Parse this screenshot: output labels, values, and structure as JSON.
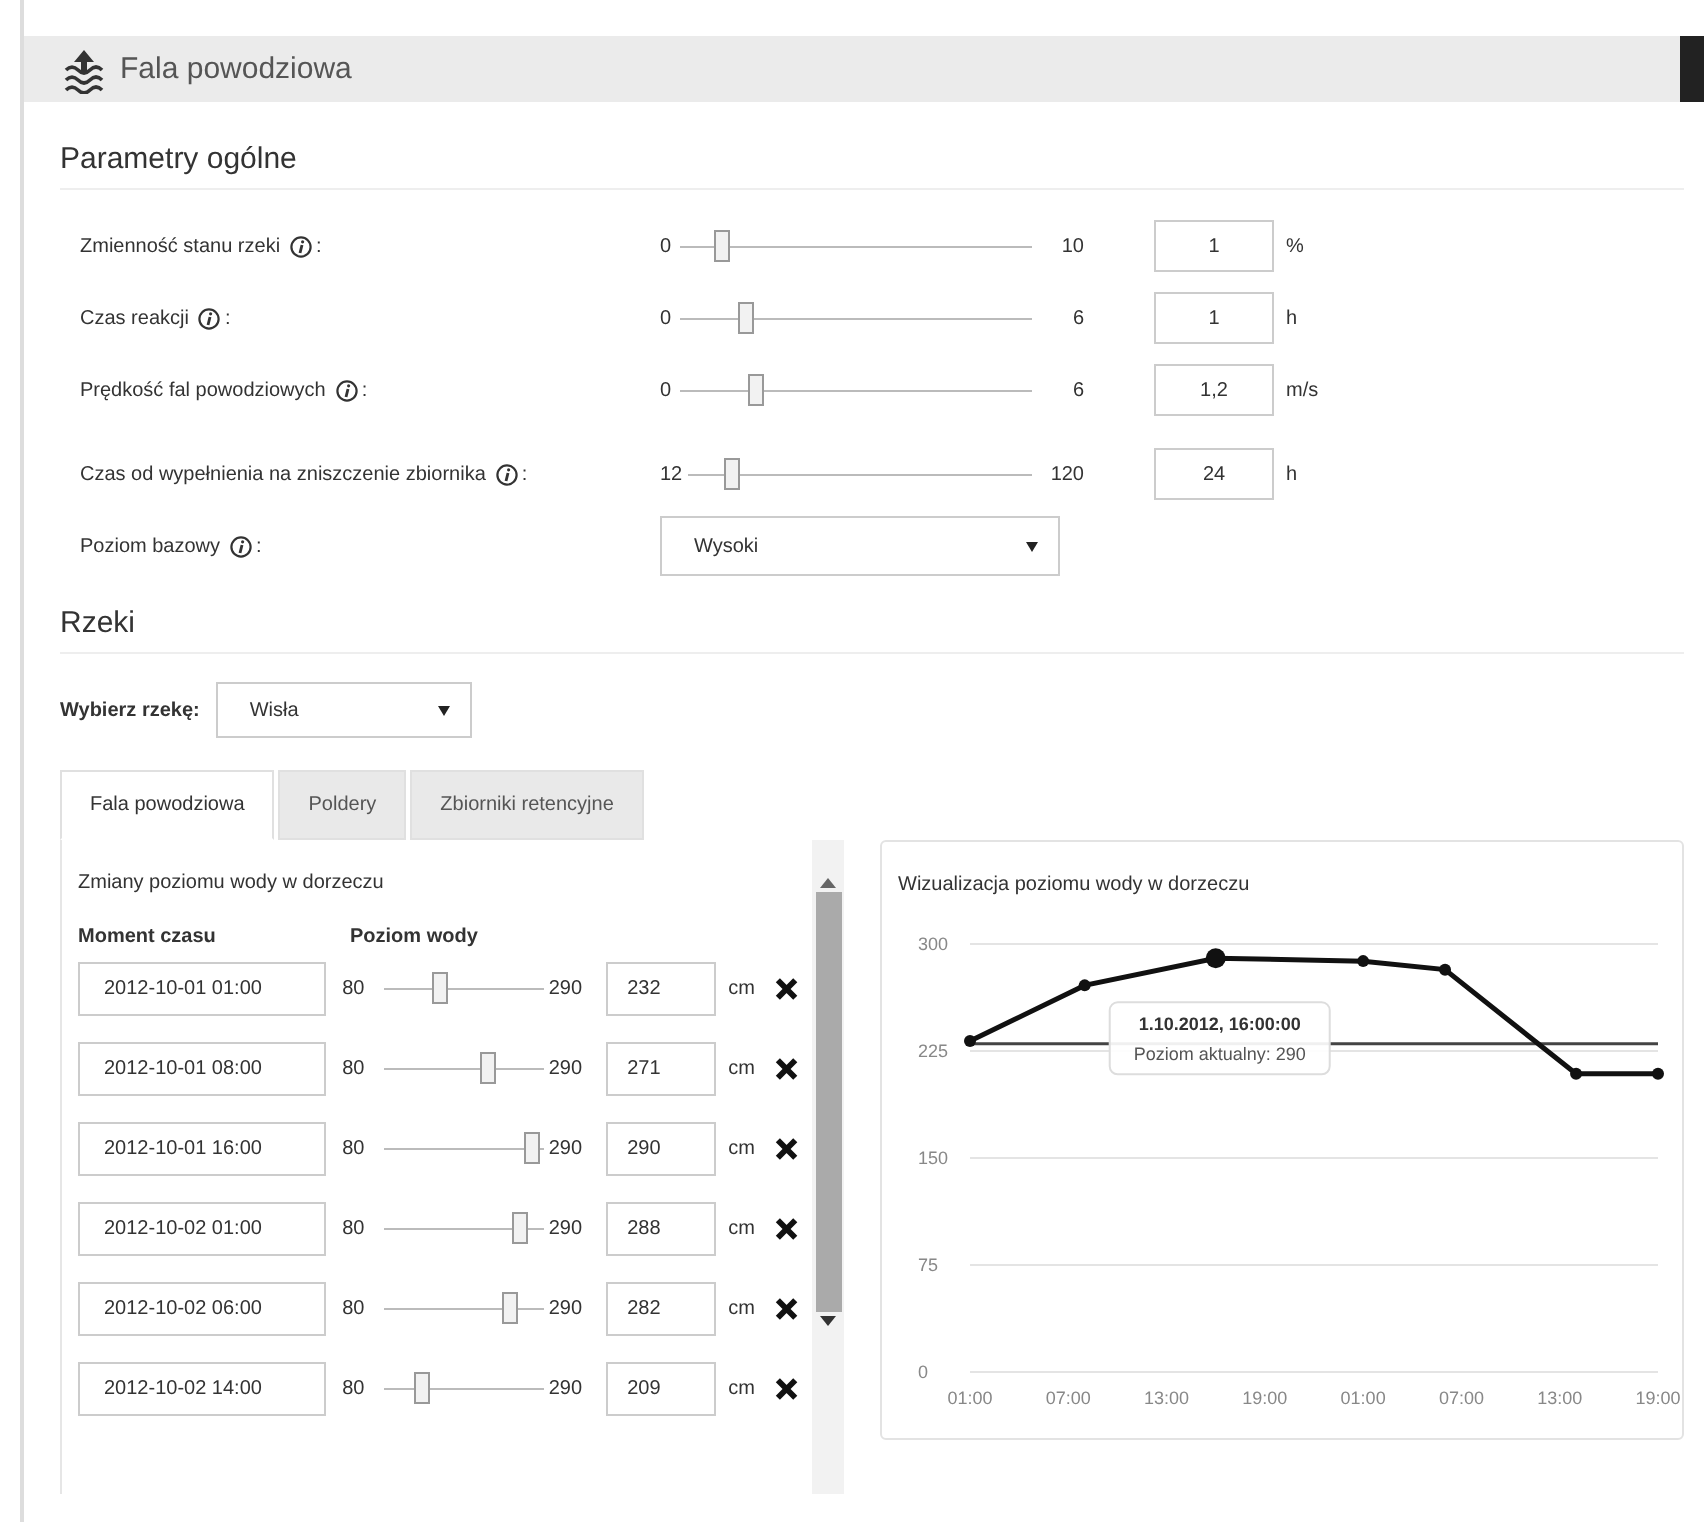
{
  "header": {
    "title": "Fala powodziowa"
  },
  "general": {
    "title": "Parametry ogólne",
    "params": [
      {
        "kind": "slider",
        "label": "Zmienność stanu rzeki",
        "colon": ":",
        "min": "0",
        "max": "10",
        "level": 0.1,
        "value": "1",
        "unit": "%"
      },
      {
        "kind": "slider",
        "label": "Czas reakcji",
        "colon": ":",
        "min": "0",
        "max": "6",
        "level": 0.17,
        "value": "1",
        "unit": "h"
      },
      {
        "kind": "slider",
        "label": "Prędkość fal powodziowych",
        "colon": ":",
        "min": "0",
        "max": "6",
        "level": 0.2,
        "value": "1,2",
        "unit": "m/s"
      },
      {
        "kind": "slider",
        "label": "Czas od wypełnienia na zniszczenie zbiornika",
        "colon": ":",
        "min": "12",
        "max": "120",
        "level": 0.11,
        "value": "24",
        "unit": "h"
      },
      {
        "kind": "select",
        "label": "Poziom bazowy",
        "colon": ":",
        "value": "Wysoki"
      }
    ]
  },
  "rivers": {
    "title": "Rzeki",
    "river_label": "Wybierz rzekę:",
    "river": "Wisła",
    "tabs": [
      {
        "label": "Fala powodziowa",
        "selected": true
      },
      {
        "label": "Poldery",
        "selected": false
      },
      {
        "label": "Zbiorniki retencyjne",
        "selected": false
      }
    ],
    "changes": {
      "title": "Zmiany poziomu wody w dorzeczu",
      "columns": [
        "Moment czasu",
        "Poziom wody"
      ],
      "rows": [
        {
          "time": "2012-10-01 01:00",
          "min": "80",
          "max": "290",
          "level": 0.33,
          "value": "232",
          "unit": "cm"
        },
        {
          "time": "2012-10-01 08:00",
          "min": "80",
          "max": "290",
          "level": 0.66,
          "value": "271",
          "unit": "cm"
        },
        {
          "time": "2012-10-01 16:00",
          "min": "80",
          "max": "290",
          "level": 0.97,
          "value": "290",
          "unit": "cm"
        },
        {
          "time": "2012-10-02 01:00",
          "min": "80",
          "max": "290",
          "level": 0.89,
          "value": "288",
          "unit": "cm"
        },
        {
          "time": "2012-10-02 06:00",
          "min": "80",
          "max": "290",
          "level": 0.82,
          "value": "282",
          "unit": "cm"
        },
        {
          "time": "2012-10-02 14:00",
          "min": "80",
          "max": "290",
          "level": 0.21,
          "value": "209",
          "unit": "cm"
        }
      ]
    },
    "visual": {
      "title": "Wizualizacja poziomu wody w dorzeczu",
      "chart_data": {
        "type": "line",
        "grid": true,
        "categories": [
          "01:00",
          null,
          null,
          null,
          null,
          null,
          "07:00",
          null,
          null,
          null,
          null,
          null,
          "13:00",
          null,
          null,
          null,
          null,
          null,
          "19:00",
          null,
          null,
          null,
          null,
          null,
          "01:00",
          null,
          null,
          null,
          null,
          null,
          "07:00",
          null,
          null,
          null,
          null,
          null,
          "13:00",
          null,
          null,
          null,
          null,
          null,
          "19:00"
        ],
        "series": [
          {
            "color": "#111111",
            "marker": "circle",
            "values": [
              232,
              null,
              null,
              null,
              null,
              null,
              null,
              271,
              null,
              null,
              null,
              null,
              null,
              null,
              null,
              290,
              null,
              null,
              null,
              null,
              null,
              null,
              null,
              null,
              288,
              null,
              null,
              null,
              null,
              282,
              null,
              null,
              null,
              null,
              null,
              null,
              null,
              209,
              null,
              null,
              null,
              null,
              209
            ]
          },
          {
            "color": "#444444",
            "values": [
              230,
              null,
              null,
              null,
              null,
              null,
              null,
              null,
              null,
              null,
              null,
              null,
              null,
              null,
              null,
              null,
              null,
              null,
              null,
              null,
              null,
              null,
              null,
              null,
              null,
              null,
              null,
              null,
              null,
              null,
              null,
              null,
              null,
              null,
              null,
              null,
              null,
              null,
              null,
              null,
              null,
              null,
              230
            ]
          }
        ],
        "ylim": [
          0,
          300
        ],
        "yticks": [
          0,
          75,
          150,
          225,
          300
        ]
      },
      "tooltip": {
        "title": "1.10.2012, 16:00:00",
        "text": "Poziom aktualny: 290"
      }
    }
  }
}
